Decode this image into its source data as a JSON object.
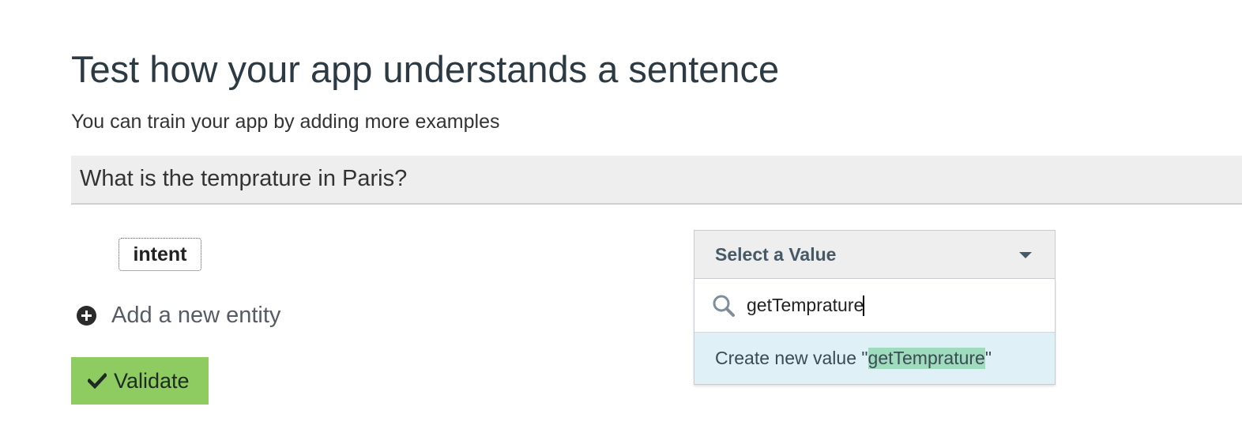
{
  "header": {
    "title": "Test how your app understands a sentence",
    "subtitle": "You can train your app by adding more examples"
  },
  "sentence": {
    "text": "What is the temprature in Paris?"
  },
  "entity": {
    "tag_label": "intent",
    "add_label": "Add a new entity",
    "add_icon": "plus-circle-icon"
  },
  "actions": {
    "validate_label": "Validate",
    "validate_icon": "check-icon",
    "validate_color": "#8ecc62"
  },
  "value_select": {
    "label": "Select a Value",
    "search_value": "getTemprature",
    "search_icon": "search-icon",
    "create_prefix": "Create new value \"",
    "create_value": "getTemprature",
    "create_suffix": "\"",
    "option_bg_color": "#dff0f6",
    "highlight_color": "#9fdbbd"
  }
}
